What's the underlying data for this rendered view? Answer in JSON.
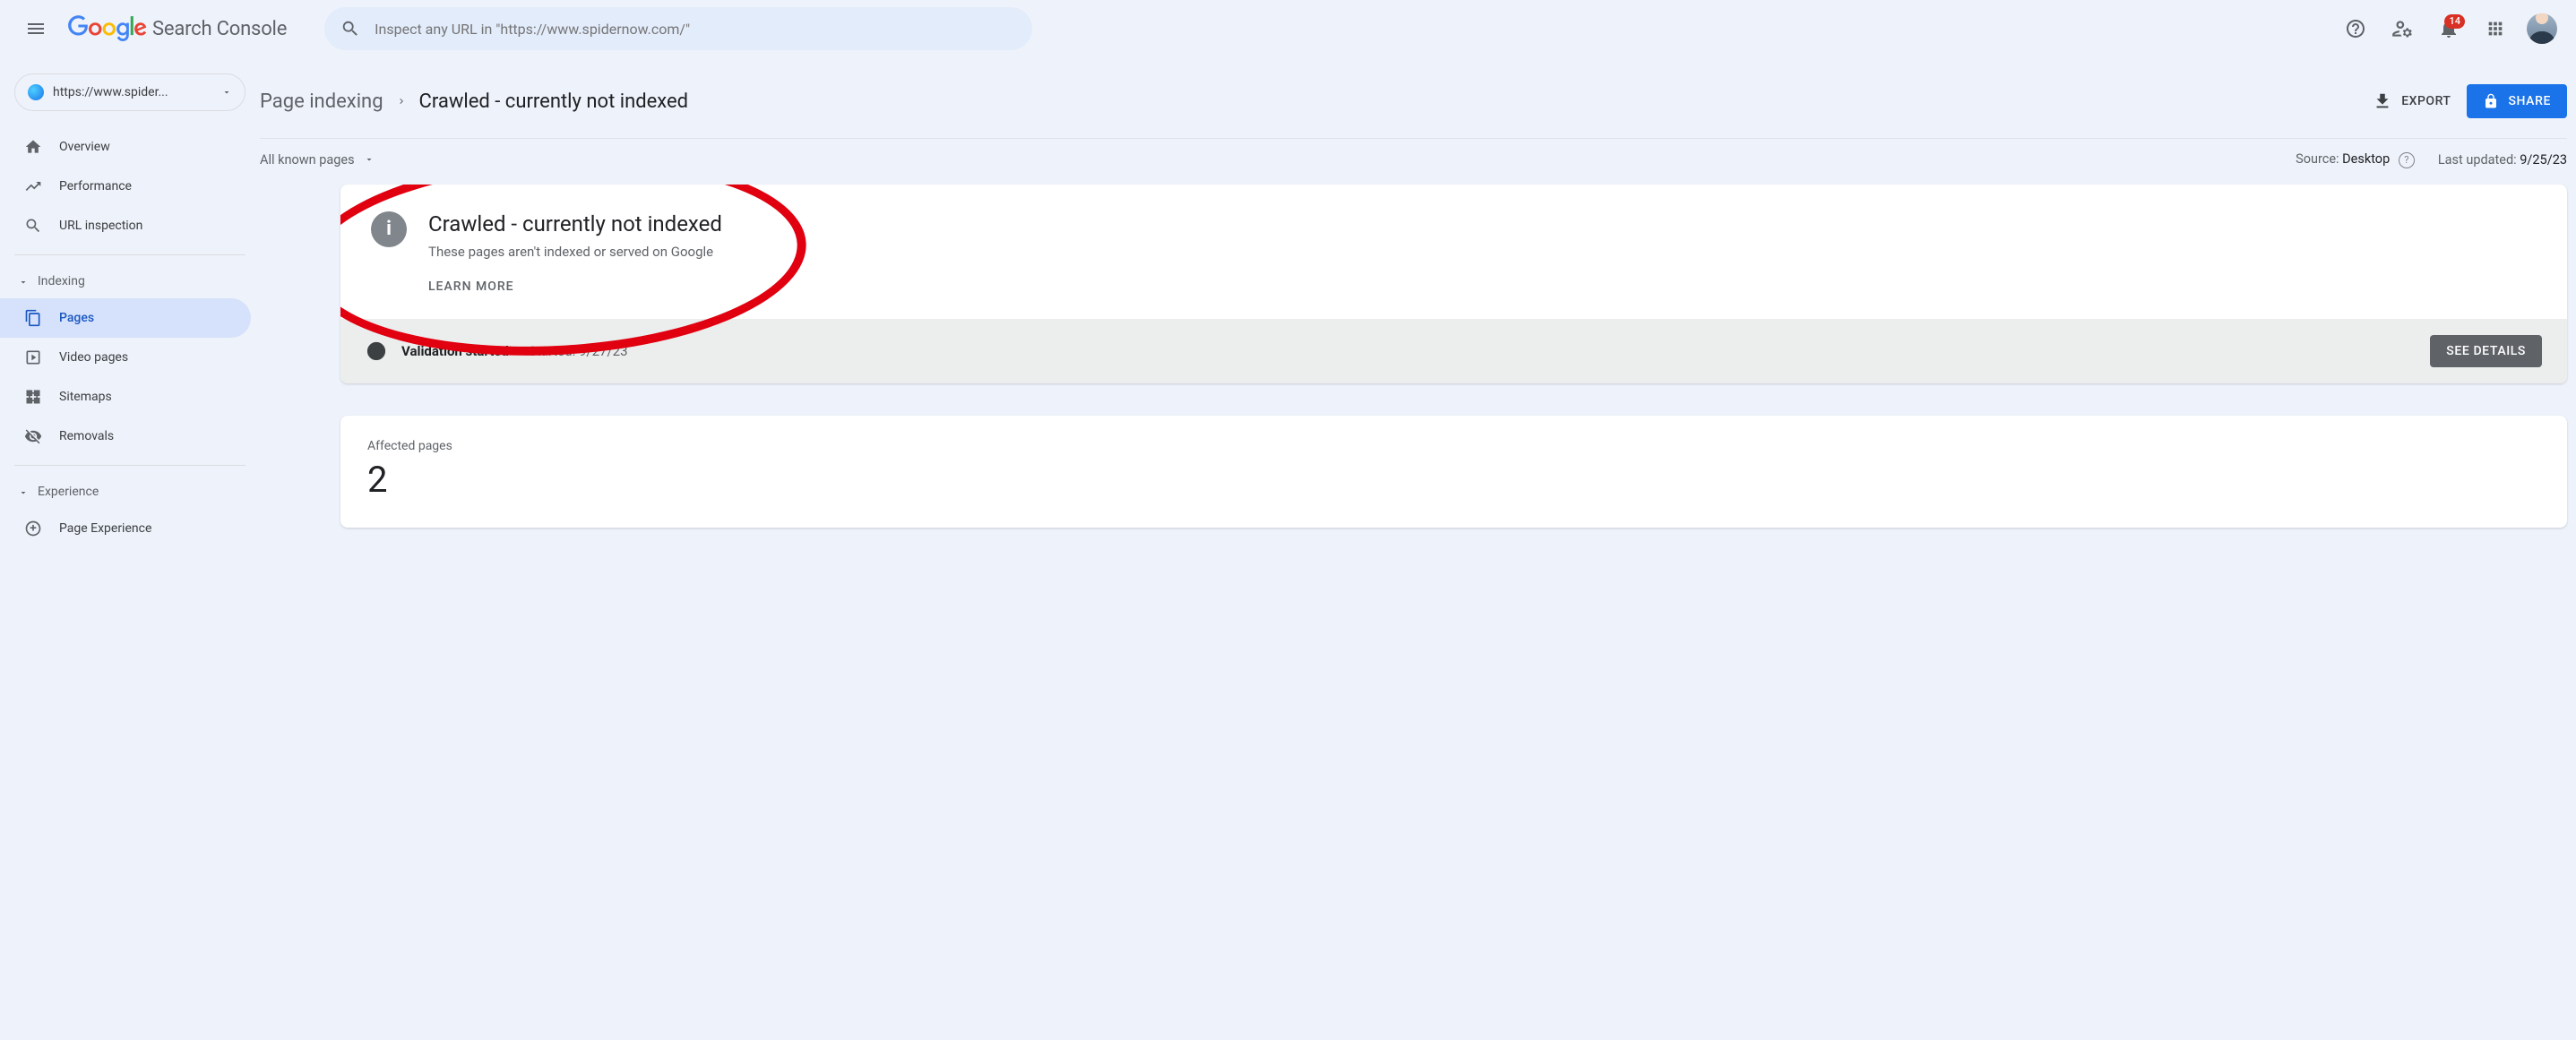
{
  "header": {
    "product_name": "Search Console",
    "search_placeholder": "Inspect any URL in \"https://www.spidernow.com/\"",
    "notification_count": "14"
  },
  "sidebar": {
    "property": "https://www.spider...",
    "items": {
      "overview": "Overview",
      "performance": "Performance",
      "url_inspection": "URL inspection"
    },
    "section_indexing": "Indexing",
    "indexing_items": {
      "pages": "Pages",
      "video_pages": "Video pages",
      "sitemaps": "Sitemaps",
      "removals": "Removals"
    },
    "section_experience": "Experience",
    "experience_items": {
      "page_experience": "Page Experience"
    }
  },
  "breadcrumb": {
    "parent": "Page indexing",
    "current": "Crawled - currently not indexed"
  },
  "actions": {
    "export": "EXPORT",
    "share": "SHARE"
  },
  "filter": {
    "label": "All known pages",
    "source_label": "Source:",
    "source_value": "Desktop",
    "updated_label": "Last updated:",
    "updated_value": "9/25/23"
  },
  "info_card": {
    "title": "Crawled - currently not indexed",
    "subtitle": "These pages aren't indexed or served on Google",
    "learn_more": "LEARN MORE"
  },
  "validation": {
    "status": "Validation started",
    "started_label": "Started:",
    "started_date": "9/27/23",
    "see_details": "SEE DETAILS"
  },
  "affected": {
    "label": "Affected pages",
    "count": "2"
  }
}
